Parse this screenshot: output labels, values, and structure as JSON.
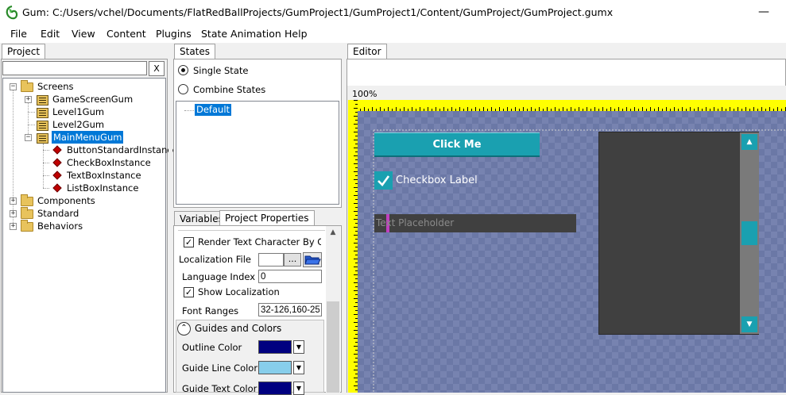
{
  "titlebar": {
    "title": "Gum: C:/Users/vchel/Documents/FlatRedBallProjects/GumProject1/GumProject1/Content/GumProject/GumProject.gumx",
    "minimize": "—",
    "maximize": "☐"
  },
  "menu": [
    "File",
    "Edit",
    "View",
    "Content",
    "Plugins",
    "State Animation",
    "Help"
  ],
  "project": {
    "tab": "Project",
    "search_value": "",
    "clear_label": "X",
    "tree": {
      "screens": "Screens",
      "game_screen": "GameScreenGum",
      "level1": "Level1Gum",
      "level2": "Level2Gum",
      "main_menu": "MainMenuGum",
      "instances": [
        "ButtonStandardInstance",
        "CheckBoxInstance",
        "TextBoxInstance",
        "ListBoxInstance"
      ],
      "components": "Components",
      "standard": "Standard",
      "behaviors": "Behaviors"
    }
  },
  "states": {
    "tab": "States",
    "single_state": "Single State",
    "combine_states": "Combine States",
    "default_state": "Default"
  },
  "properties": {
    "tabs": [
      "Variables",
      "Project Properties"
    ],
    "render_text": "Render Text Character By Cl",
    "localization_file_label": "Localization File",
    "localization_file_value": "",
    "browse_label": "...",
    "language_index_label": "Language Index",
    "language_index_value": "0",
    "show_localization": "Show Localization",
    "font_ranges_label": "Font Ranges",
    "font_ranges_value": "32-126,160-25",
    "guides_header": "Guides and Colors",
    "outline_color_label": "Outline Color",
    "guide_line_color_label": "Guide Line Color",
    "guide_text_color_label": "Guide Text Color",
    "colors": {
      "outline": "#000080",
      "guide_line": "#87ceeb",
      "guide_text": "#000080"
    }
  },
  "editor": {
    "tab": "Editor",
    "zoom": "100%",
    "button_label": "Click Me",
    "checkbox_label": "Checkbox Label",
    "textbox_placeholder": "Text Placeholder",
    "colors": {
      "ruler": "#ffff00",
      "accent": "#1aa0b0",
      "canvas": "#6b78a6",
      "listbox": "#404040"
    }
  }
}
